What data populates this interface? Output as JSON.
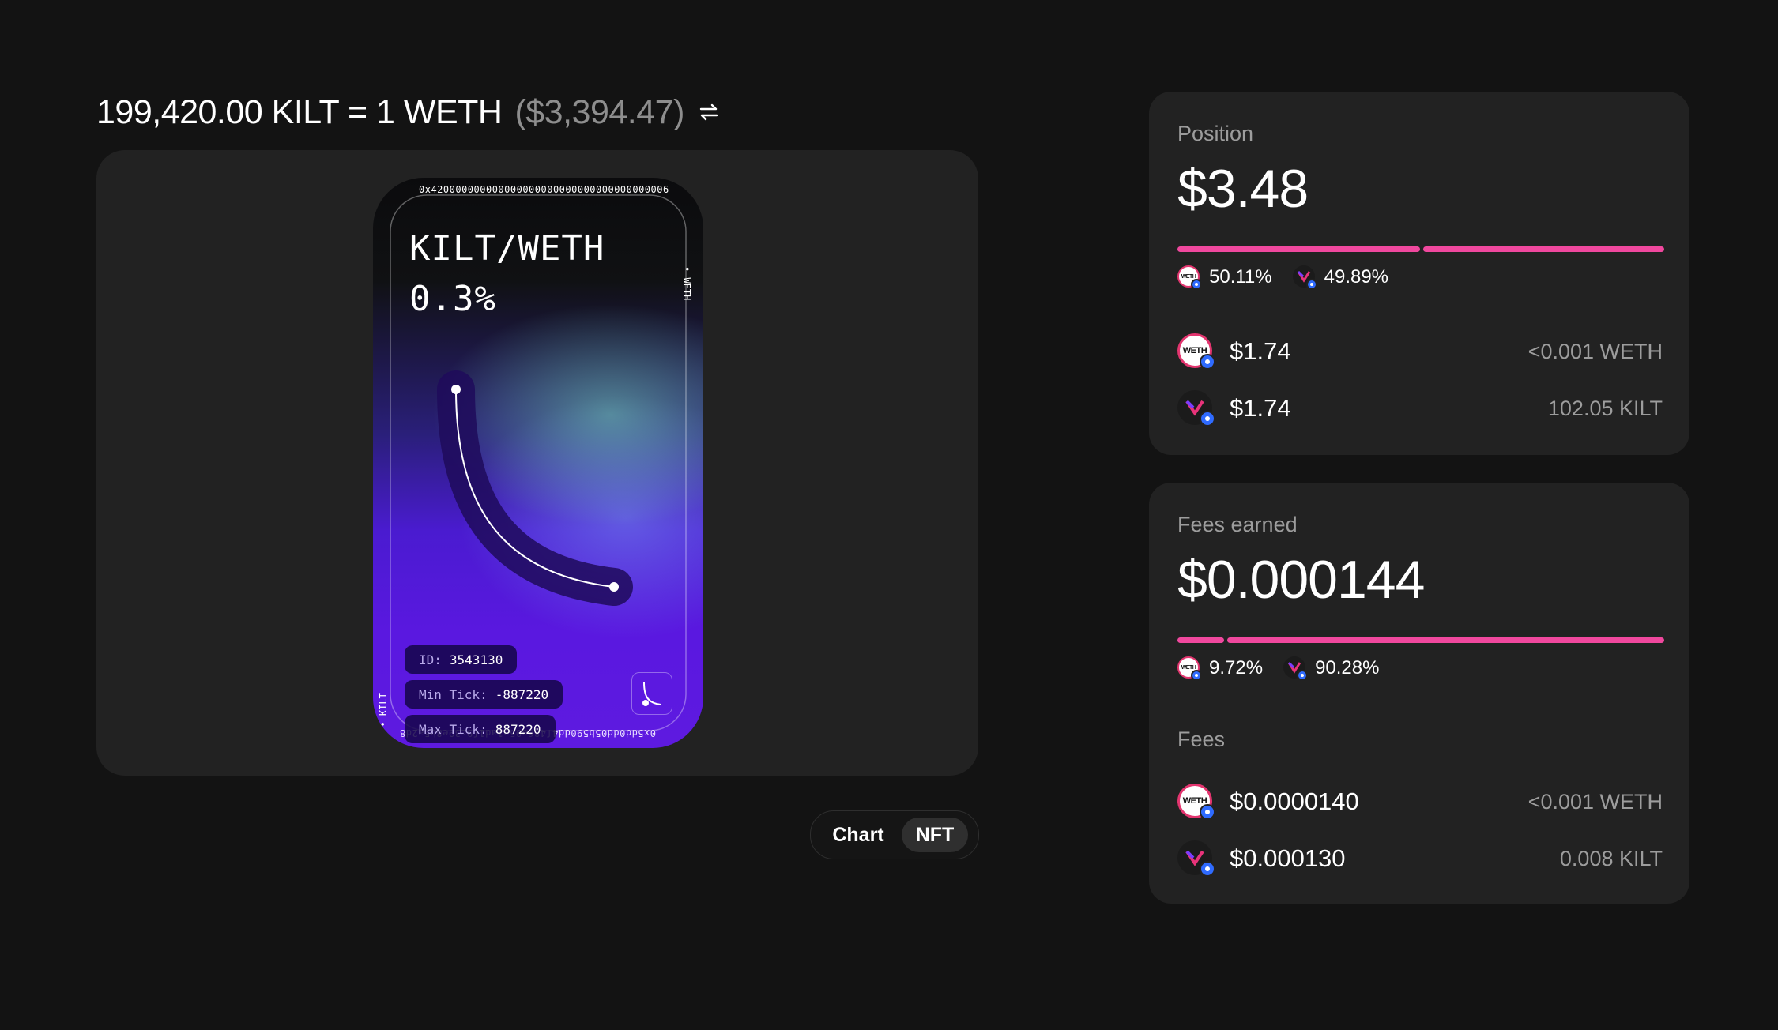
{
  "price": {
    "main": "199,420.00 KILT = 1 WETH",
    "usd": "($3,394.47)"
  },
  "nft": {
    "pair": "KILT/WETH",
    "fee": "0.3%",
    "address_top": "0x420000000000000000000000000000000000006",
    "address_bottom": "0x5dd0dd05b590dd4f486a95a1ad1f9c39e8b5a2d8",
    "side_right": "• WETH",
    "side_left": "8 • KILT",
    "id_label": "ID:",
    "id_value": "3543130",
    "min_tick_label": "Min Tick:",
    "min_tick_value": "-887220",
    "max_tick_label": "Max Tick:",
    "max_tick_value": "887220"
  },
  "view_toggle": {
    "chart_label": "Chart",
    "nft_label": "NFT",
    "selected": "NFT"
  },
  "position": {
    "label": "Position",
    "value": "$3.48",
    "weth_pct": "50.11%",
    "kilt_pct": "49.89%",
    "weth_share": 0.5011,
    "kilt_share": 0.4989,
    "weth_usd": "$1.74",
    "weth_amount": "<0.001 WETH",
    "kilt_usd": "$1.74",
    "kilt_amount": "102.05 KILT"
  },
  "fees": {
    "label": "Fees earned",
    "value": "$0.000144",
    "weth_pct": "9.72%",
    "kilt_pct": "90.28%",
    "weth_share": 0.0972,
    "kilt_share": 0.9028,
    "section_label": "Fees",
    "weth_usd": "$0.0000140",
    "weth_amount": "<0.001 WETH",
    "kilt_usd": "$0.000130",
    "kilt_amount": "0.008 KILT"
  },
  "tokens": {
    "weth_logo_text": "WETH",
    "weth_icon": "weth-token-icon",
    "kilt_icon": "kilt-token-icon",
    "chain_icon": "base-chain-icon"
  },
  "colors": {
    "background": "#131313",
    "card": "#222222",
    "accent_bar": "#f0489e",
    "muted_text": "#9d9d9d",
    "nft_purple": "#5a18e0"
  }
}
